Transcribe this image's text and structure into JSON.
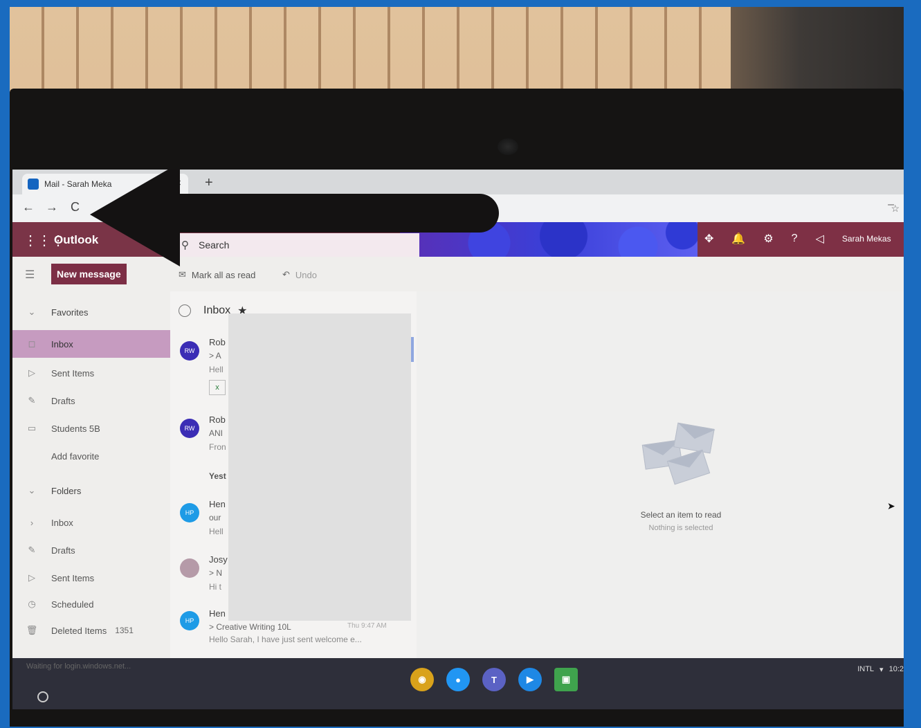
{
  "browser": {
    "tab_title": "Mail - Sarah Meka",
    "close_glyph": "×",
    "newtab_glyph": "+",
    "back_glyph": "←",
    "forward_glyph": "→",
    "reload_glyph": "C",
    "minimize_glyph": "–",
    "star_glyph": "☆"
  },
  "outlook": {
    "app_name": "Outlook",
    "waffle_glyph": "⋮⋮⋮",
    "search_placeholder": "Search",
    "search_icon": "⚲",
    "user_name": "Sarah Mekas"
  },
  "header_icons": [
    "✥",
    "🔔",
    "⚙",
    "?",
    "◁"
  ],
  "toolbar": {
    "new_message": "New message",
    "mark_all_read": "Mark all as read",
    "undo": "Undo"
  },
  "nav": {
    "hamburger": "☰",
    "favorites_label": "Favorites",
    "favorites": [
      {
        "label": "Inbox",
        "icon": "◻",
        "active": true
      },
      {
        "label": "Sent Items",
        "icon": "▷",
        "active": false
      },
      {
        "label": "Drafts",
        "icon": "✎",
        "active": false
      },
      {
        "label": "Students 5B",
        "icon": "▭",
        "active": false
      },
      {
        "label": "Add favorite",
        "icon": "",
        "active": false
      }
    ],
    "folders_label": "Folders",
    "folders": [
      {
        "label": "Inbox",
        "icon": "›",
        "count": ""
      },
      {
        "label": "Drafts",
        "icon": "✎",
        "count": ""
      },
      {
        "label": "Sent Items",
        "icon": "▷",
        "count": ""
      },
      {
        "label": "Scheduled",
        "icon": "◷",
        "count": ""
      },
      {
        "label": "Deleted Items",
        "icon": "🗑",
        "count": "1351"
      }
    ]
  },
  "list": {
    "header": "Inbox",
    "messages": [
      {
        "initials": "RW",
        "line1": "Rob",
        "line2": "> A",
        "line3": "Hell",
        "attachment": true
      },
      {
        "initials": "RW",
        "line1": "Rob",
        "line2": "ANI",
        "line3": "Fron",
        "attachment": false
      },
      {
        "initials": "HP",
        "line1": "Hen",
        "line2": "our",
        "line3": "Hell",
        "attachment": false
      },
      {
        "initials": "",
        "line1": "Josy",
        "line2": "> N",
        "line3": "Hi t",
        "attachment": false
      },
      {
        "initials": "HP",
        "line1": "Hen",
        "line2": "> Creative Writing 10L",
        "line3": "Hello Sarah, I have just sent welcome e...",
        "time": "Thu 9:47 AM",
        "attachment": false
      }
    ],
    "day_label": "Yest"
  },
  "reading_pane": {
    "title": "Select an item to read",
    "subtitle": "Nothing is selected"
  },
  "status": "Waiting for login.windows.net...",
  "shelf": {
    "apps": [
      {
        "name": "chrome",
        "glyph": "◉",
        "color": "#d9a21b"
      },
      {
        "name": "messages",
        "glyph": "●",
        "color": "#2196f3"
      },
      {
        "name": "teams",
        "glyph": "T",
        "color": "#5b62c4"
      },
      {
        "name": "meet",
        "glyph": "▶",
        "color": "#1e88e5"
      },
      {
        "name": "classroom",
        "glyph": "▣",
        "color": "#3fa34d"
      }
    ],
    "tray_text": "INTL",
    "clock": "10:2"
  }
}
